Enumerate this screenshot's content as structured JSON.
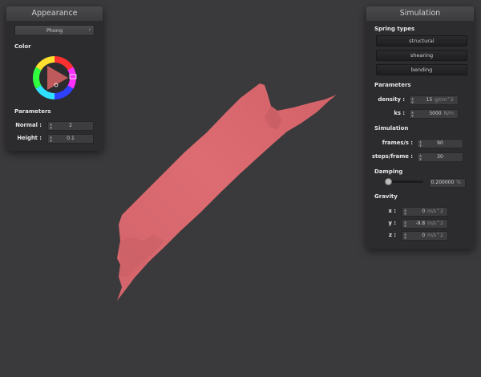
{
  "appearance": {
    "title": "Appearance",
    "shading_mode": "Phong",
    "color_label": "Color",
    "parameters_label": "Parameters",
    "normal": {
      "label": "Normal :",
      "value": "2"
    },
    "height": {
      "label": "Height :",
      "value": "0.1"
    },
    "color_hex": "#e06a6c"
  },
  "simulation": {
    "title": "Simulation",
    "spring_types_label": "Spring types",
    "springs": [
      "structural",
      "shearing",
      "bending"
    ],
    "parameters_label": "Parameters",
    "density": {
      "label": "density :",
      "value": "15",
      "unit": "g/cm^2"
    },
    "ks": {
      "label": "ks :",
      "value": "5000",
      "unit": "N/m"
    },
    "simulation_label": "Simulation",
    "frames": {
      "label": "frames/s :",
      "value": "90"
    },
    "steps": {
      "label": "steps/frame :",
      "value": "30"
    },
    "damping_label": "Damping",
    "damping": {
      "value": "0.200000",
      "unit": "%",
      "fraction": 0.02
    },
    "gravity_label": "Gravity",
    "gravity": {
      "x": {
        "label": "x :",
        "value": "0",
        "unit": "m/s^2"
      },
      "y": {
        "label": "y :",
        "value": "-9.8",
        "unit": "m/s^2"
      },
      "z": {
        "label": "z :",
        "value": "0",
        "unit": "m/s^2"
      }
    }
  },
  "cloth_color": "#d9686e"
}
